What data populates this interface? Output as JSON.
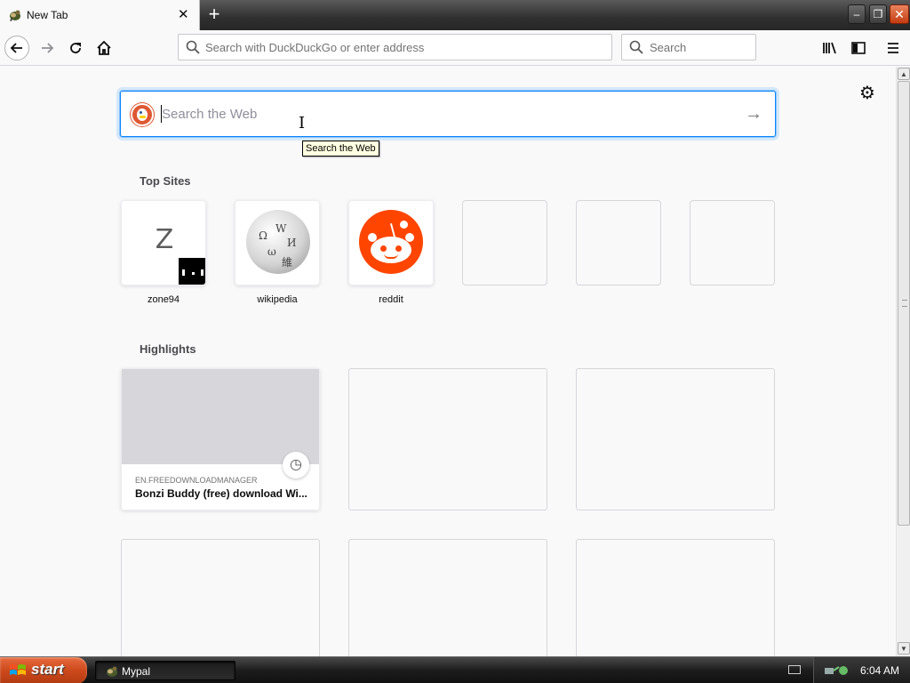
{
  "tab": {
    "title": "New Tab",
    "close": "✕",
    "new_tab": "+"
  },
  "window": {
    "minimize": "–",
    "maximize": "❐",
    "close": "✕"
  },
  "nav": {
    "url_placeholder": "Search with DuckDuckGo or enter address",
    "search_placeholder": "Search"
  },
  "content": {
    "web_search_placeholder": "Search the Web",
    "tooltip": "Search the Web",
    "top_sites_title": "Top Sites",
    "top_sites": [
      {
        "label": "zone94",
        "letter": "Z"
      },
      {
        "label": "wikipedia"
      },
      {
        "label": "reddit"
      }
    ],
    "highlights_title": "Highlights",
    "highlights": [
      {
        "host": "EN.FREEDOWNLOADMANAGER",
        "title": "Bonzi Buddy (free) download Wi..."
      }
    ]
  },
  "taskbar": {
    "start_label": "start",
    "task_label": "Mypal",
    "clock": "6:04 AM"
  },
  "colors": {
    "accent": "#0a84ff",
    "reddit": "#ff4500",
    "duckduckgo": "#de5833",
    "start_button": "#cd4a1c"
  },
  "icons": {
    "back": "arrow-left-icon",
    "forward": "arrow-right-icon",
    "reload": "reload-icon",
    "home": "home-icon",
    "library": "library-icon",
    "sidebar": "sidebar-icon",
    "menu": "hamburger-menu-icon",
    "settings": "gear-icon"
  }
}
